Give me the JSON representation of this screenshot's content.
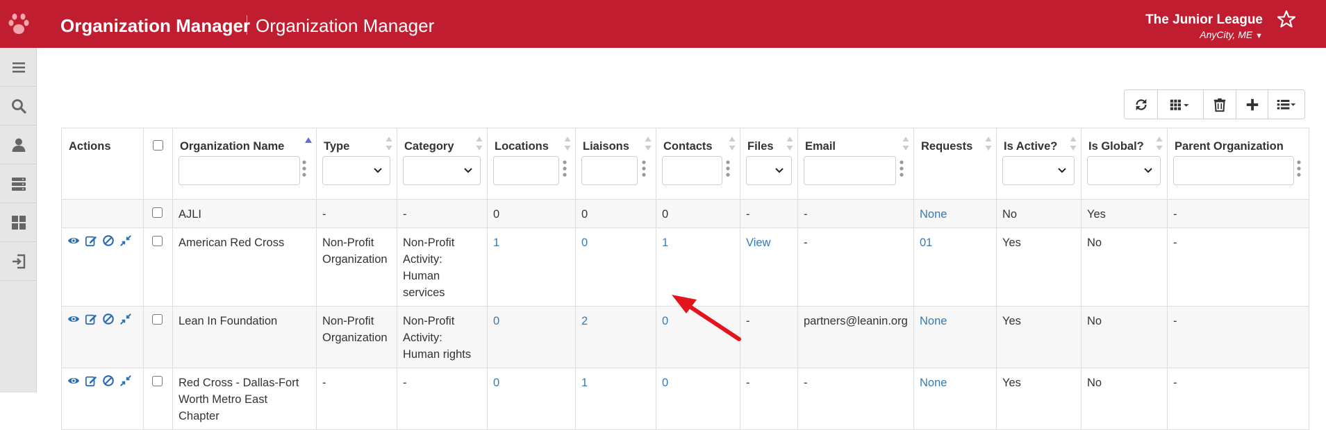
{
  "header": {
    "app_title": "Organization Manager",
    "page_title": "Organization Manager",
    "org_name": "The Junior League",
    "org_location": "AnyCity, ME",
    "brand_color": "#c11d30"
  },
  "sidebar": {
    "items": [
      {
        "icon": "menu-icon"
      },
      {
        "icon": "search-icon"
      },
      {
        "icon": "user-icon"
      },
      {
        "icon": "server-icon"
      },
      {
        "icon": "dashboard-icon"
      },
      {
        "icon": "sign-in-icon"
      }
    ]
  },
  "toolbar": {
    "buttons": [
      "refresh-icon",
      "columns-icon",
      "trash-icon",
      "plus-icon",
      "list-icon"
    ]
  },
  "table": {
    "columns": {
      "actions": "Actions",
      "name": "Organization Name",
      "type": "Type",
      "category": "Category",
      "locations": "Locations",
      "liaisons": "Liaisons",
      "contacts": "Contacts",
      "files": "Files",
      "email": "Email",
      "requests": "Requests",
      "active": "Is Active?",
      "global": "Is Global?",
      "parent": "Parent Organization"
    },
    "rows": [
      {
        "name": "AJLI",
        "type": "-",
        "category": "-",
        "locations": "0",
        "liaisons": "0",
        "contacts": "0",
        "files": "-",
        "email": "-",
        "requests": "None",
        "active": "No",
        "global": "Yes",
        "parent": "-"
      },
      {
        "name": "American Red Cross",
        "type": "Non-Profit Organization",
        "category": "Non-Profit Activity: Human services",
        "locations": "1",
        "liaisons": "0",
        "contacts": "1",
        "files": "View",
        "email": "-",
        "requests": "01",
        "active": "Yes",
        "global": "No",
        "parent": "-"
      },
      {
        "name": "Lean In Foundation",
        "type": "Non-Profit Organization",
        "category": "Non-Profit Activity: Human rights",
        "locations": "0",
        "liaisons": "2",
        "contacts": "0",
        "files": "-",
        "email": "partners@leanin.org",
        "requests": "None",
        "active": "Yes",
        "global": "No",
        "parent": "-"
      },
      {
        "name": "Red Cross - Dallas-Fort Worth Metro East Chapter",
        "type": "-",
        "category": "-",
        "locations": "0",
        "liaisons": "1",
        "contacts": "0",
        "files": "-",
        "email": "-",
        "requests": "None",
        "active": "Yes",
        "global": "No",
        "parent": "-"
      }
    ]
  },
  "link_color": "#337ab7"
}
